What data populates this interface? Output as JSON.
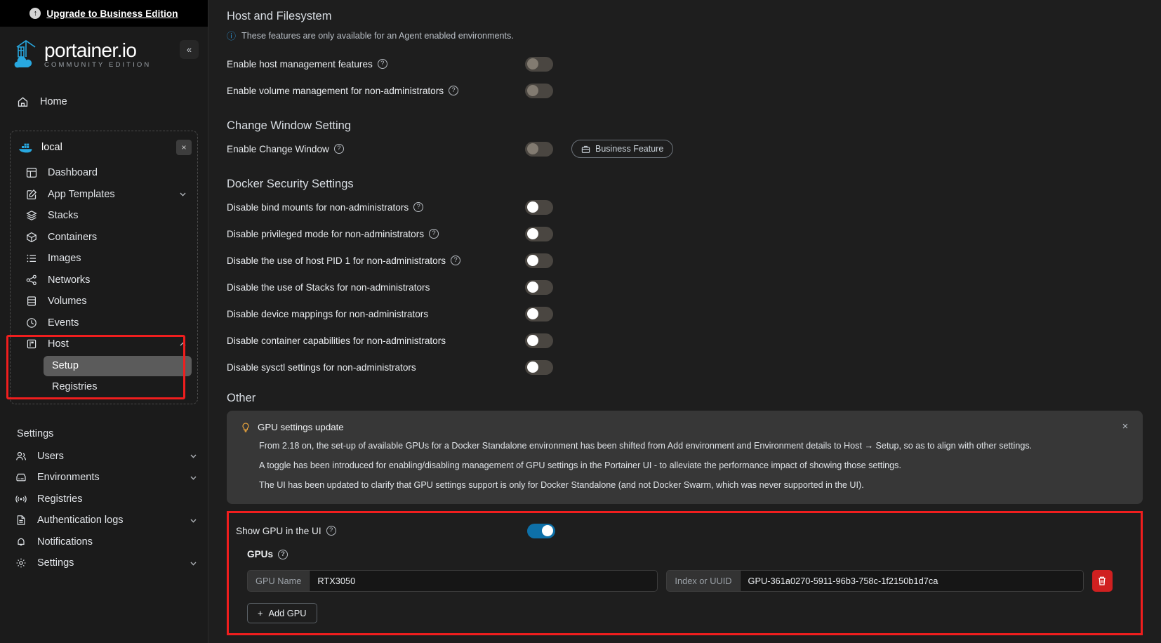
{
  "sidebar": {
    "upgrade_banner": {
      "label": "Upgrade to Business Edition",
      "icon": "upgrade-arrow-icon"
    },
    "brand": {
      "name": "portainer.io",
      "edition": "COMMUNITY EDITION"
    },
    "collapse_label": "«",
    "home": {
      "label": "Home",
      "icon": "home-icon"
    },
    "environment": {
      "name": "local",
      "icon": "docker-icon",
      "close_label": "×"
    },
    "nav_items": [
      {
        "label": "Dashboard",
        "icon": "dashboard-icon",
        "expandable": false
      },
      {
        "label": "App Templates",
        "icon": "app-templates-icon",
        "expandable": true,
        "chevron": "down"
      },
      {
        "label": "Stacks",
        "icon": "stacks-icon",
        "expandable": false
      },
      {
        "label": "Containers",
        "icon": "containers-icon",
        "expandable": false
      },
      {
        "label": "Images",
        "icon": "images-icon",
        "expandable": false
      },
      {
        "label": "Networks",
        "icon": "networks-icon",
        "expandable": false
      },
      {
        "label": "Volumes",
        "icon": "volumes-icon",
        "expandable": false
      },
      {
        "label": "Events",
        "icon": "events-icon",
        "expandable": false
      },
      {
        "label": "Host",
        "icon": "host-icon",
        "expandable": true,
        "chevron": "up"
      }
    ],
    "host_children": [
      {
        "label": "Setup",
        "active": true
      },
      {
        "label": "Registries",
        "active": false
      }
    ],
    "settings_section_label": "Settings",
    "settings_items": [
      {
        "label": "Users",
        "icon": "users-icon",
        "expandable": true
      },
      {
        "label": "Environments",
        "icon": "environments-icon",
        "expandable": true
      },
      {
        "label": "Registries",
        "icon": "registries-broadcast-icon",
        "expandable": false
      },
      {
        "label": "Authentication logs",
        "icon": "auth-logs-icon",
        "expandable": true
      },
      {
        "label": "Notifications",
        "icon": "bell-icon",
        "expandable": false
      },
      {
        "label": "Settings",
        "icon": "gear-icon",
        "expandable": true
      }
    ],
    "highlight_color": "#f01e1e"
  },
  "main": {
    "host_filesystem": {
      "title": "Host and Filesystem",
      "note": "These features are only available for an Agent enabled environments.",
      "rows": [
        {
          "label": "Enable host management features",
          "help": true,
          "toggle": "off-dim"
        },
        {
          "label": "Enable volume management for non-administrators",
          "help": true,
          "toggle": "off-dim"
        }
      ]
    },
    "change_window": {
      "title": "Change Window Setting",
      "rows": [
        {
          "label": "Enable Change Window",
          "help": true,
          "toggle": "off-dim"
        }
      ],
      "business_badge": {
        "label": "Business Feature",
        "icon": "briefcase-icon"
      }
    },
    "docker_security": {
      "title": "Docker Security Settings",
      "rows": [
        {
          "label": "Disable bind mounts for non-administrators",
          "help": true,
          "toggle": "off-white"
        },
        {
          "label": "Disable privileged mode for non-administrators",
          "help": true,
          "toggle": "off-white"
        },
        {
          "label": "Disable the use of host PID 1 for non-administrators",
          "help": true,
          "toggle": "off-white"
        },
        {
          "label": "Disable the use of Stacks for non-administrators",
          "help": false,
          "toggle": "off-white"
        },
        {
          "label": "Disable device mappings for non-administrators",
          "help": false,
          "toggle": "off-white"
        },
        {
          "label": "Disable container capabilities for non-administrators",
          "help": false,
          "toggle": "off-white"
        },
        {
          "label": "Disable sysctl settings for non-administrators",
          "help": false,
          "toggle": "off-white"
        }
      ]
    },
    "other": {
      "title": "Other",
      "notice": {
        "icon": "lightbulb-icon",
        "heading": "GPU settings update",
        "close_label": "×",
        "paragraphs": [
          "From 2.18 on, the set-up of available GPUs for a Docker Standalone environment has been shifted from Add environment and Environment details to Host → Setup, so as to align with other settings.",
          "A toggle has been introduced for enabling/disabling management of GPU settings in the Portainer UI - to alleviate the performance impact of showing those settings.",
          "The UI has been updated to clarify that GPU settings support is only for Docker Standalone (and not Docker Swarm, which was never supported in the UI)."
        ]
      }
    },
    "gpu_panel": {
      "show_gpu": {
        "label": "Show GPU in the UI",
        "help": true,
        "toggle": "on"
      },
      "gpus_label": "GPUs",
      "gpus_help": true,
      "gpu_rows": [
        {
          "name_prefix": "GPU Name",
          "name_value": "RTX3050",
          "name_placeholder": "GPU Name",
          "uuid_prefix": "Index or UUID",
          "uuid_value": "GPU-361a0270-5911-96b3-758c-1f2150b1d7ca",
          "uuid_placeholder": "Index or UUID",
          "delete_icon": "trash-icon"
        }
      ],
      "add_gpu_label": "Add GPU",
      "add_gpu_icon": "plus-icon",
      "highlight_color": "#f01e1e"
    }
  },
  "colors": {
    "accent_blue": "#0e70a8",
    "highlight_red": "#f01e1e",
    "danger_red": "#d02020",
    "bulb_amber": "#e8a33d",
    "info_blue": "#2f8ecc"
  }
}
